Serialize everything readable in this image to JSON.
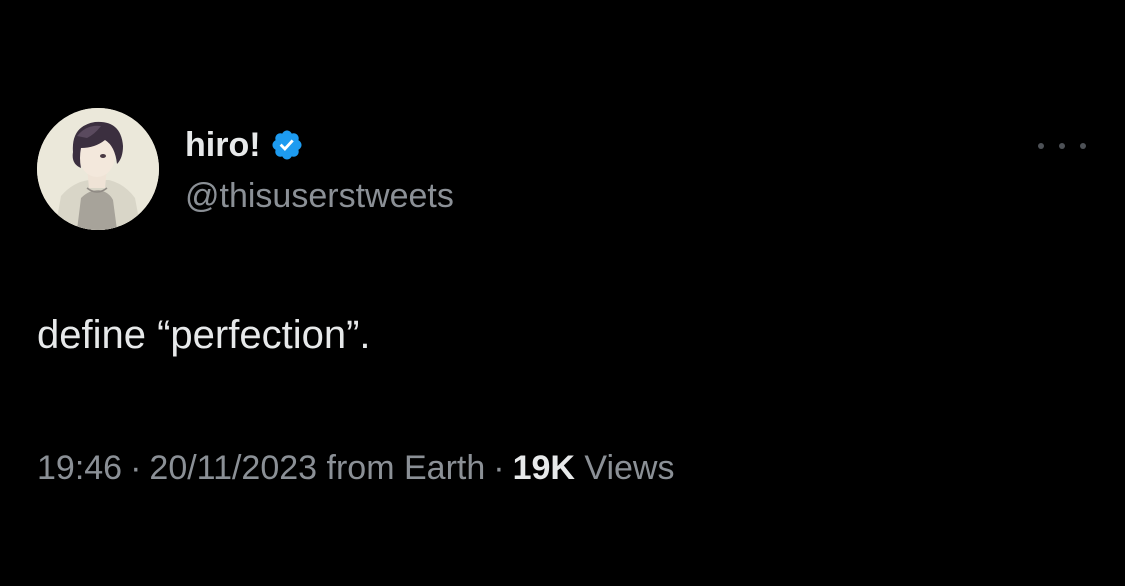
{
  "tweet": {
    "author": {
      "display_name": "hiro!",
      "handle": "@thisuserstweets",
      "verified": true,
      "avatar_icon": "anime-character-avatar"
    },
    "text": "define “perfection”.",
    "meta": {
      "time": "19:46",
      "date": "20/11/2023",
      "source": "from Earth",
      "separator": "·",
      "views_count": "19K",
      "views_label": "Views"
    },
    "more_icon": "more-options-icon"
  },
  "colors": {
    "background": "#000000",
    "primary_text": "#e7e9ea",
    "secondary_text": "#8b9096",
    "verified_badge": "#1d9bf0"
  }
}
